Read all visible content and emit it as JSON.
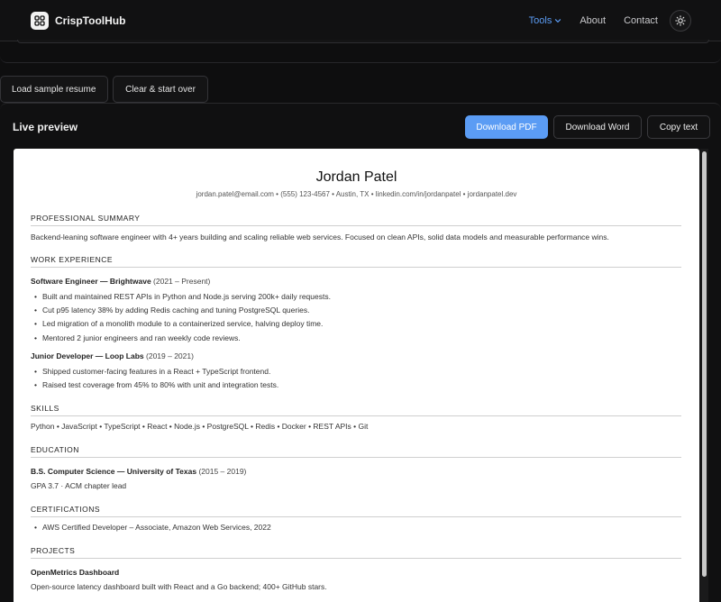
{
  "nav": {
    "brand": "CrispToolHub",
    "links": [
      {
        "label": "Tools"
      },
      {
        "label": "About"
      },
      {
        "label": "Contact"
      }
    ]
  },
  "actions": {
    "load_sample": "Load sample resume",
    "clear": "Clear & start over"
  },
  "preview": {
    "title": "Live preview",
    "download_pdf": "Download PDF",
    "download_word": "Download Word",
    "copy_text": "Copy text"
  },
  "resume": {
    "name": "Jordan Patel",
    "contact": "jordan.patel@email.com • (555) 123-4567 • Austin, TX • linkedin.com/in/jordanpatel • jordanpatel.dev",
    "headings": {
      "summary": "PROFESSIONAL SUMMARY",
      "experience": "WORK EXPERIENCE",
      "skills": "SKILLS",
      "education": "EDUCATION",
      "certifications": "CERTIFICATIONS",
      "projects": "PROJECTS"
    },
    "summary": "Backend-leaning software engineer with 4+ years building and scaling reliable web services. Focused on clean APIs, solid data models and measurable performance wins.",
    "jobs": [
      {
        "title": "Software Engineer — Brightwave",
        "dates": "(2021 – Present)",
        "bullets": [
          "Built and maintained REST APIs in Python and Node.js serving 200k+ daily requests.",
          "Cut p95 latency 38% by adding Redis caching and tuning PostgreSQL queries.",
          "Led migration of a monolith module to a containerized service, halving deploy time.",
          "Mentored 2 junior engineers and ran weekly code reviews."
        ]
      },
      {
        "title": "Junior Developer — Loop Labs",
        "dates": "(2019 – 2021)",
        "bullets": [
          "Shipped customer-facing features in a React + TypeScript frontend.",
          "Raised test coverage from 45% to 80% with unit and integration tests."
        ]
      }
    ],
    "skills": "Python • JavaScript • TypeScript • React • Node.js • PostgreSQL • Redis • Docker • REST APIs • Git",
    "education": {
      "degree": "B.S. Computer Science — University of Texas",
      "dates": "(2015 – 2019)",
      "detail": "GPA 3.7 · ACM chapter lead"
    },
    "certifications": [
      "AWS Certified Developer – Associate, Amazon Web Services, 2022"
    ],
    "projects": [
      {
        "title": "OpenMetrics Dashboard",
        "description": "Open-source latency dashboard built with React and a Go backend; 400+ GitHub stars."
      }
    ]
  }
}
